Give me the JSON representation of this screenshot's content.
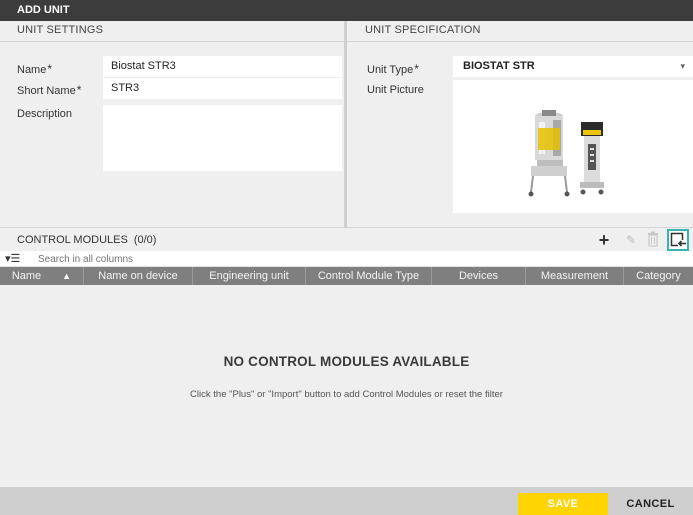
{
  "window": {
    "title": "ADD UNIT"
  },
  "unit_settings": {
    "header": "UNIT SETTINGS",
    "name_label": "Name",
    "name_value": "Biostat STR3",
    "short_name_label": "Short Name",
    "short_name_value": "STR3",
    "description_label": "Description",
    "description_value": "",
    "required_mark": "*"
  },
  "unit_specification": {
    "header": "UNIT SPECIFICATION",
    "unit_type_label": "Unit Type",
    "unit_type_value": "BIOSTAT STR",
    "unit_picture_label": "Unit Picture",
    "required_mark": "*"
  },
  "control_modules": {
    "title": "CONTROL MODULES",
    "count": "(0/0)",
    "search_placeholder": "Search in all columns",
    "columns": [
      "Name",
      "Name on device",
      "Engineering unit",
      "Control Module Type",
      "Devices",
      "Measurement",
      "Category"
    ],
    "empty_title": "NO CONTROL MODULES AVAILABLE",
    "empty_hint": "Click the \"Plus\" or \"Import\" button to add Control Modules or reset the filter",
    "accent_color": "#37b4b0"
  },
  "footer": {
    "save_label": "SAVE",
    "cancel_label": "CANCEL",
    "save_color": "#ffd400"
  }
}
